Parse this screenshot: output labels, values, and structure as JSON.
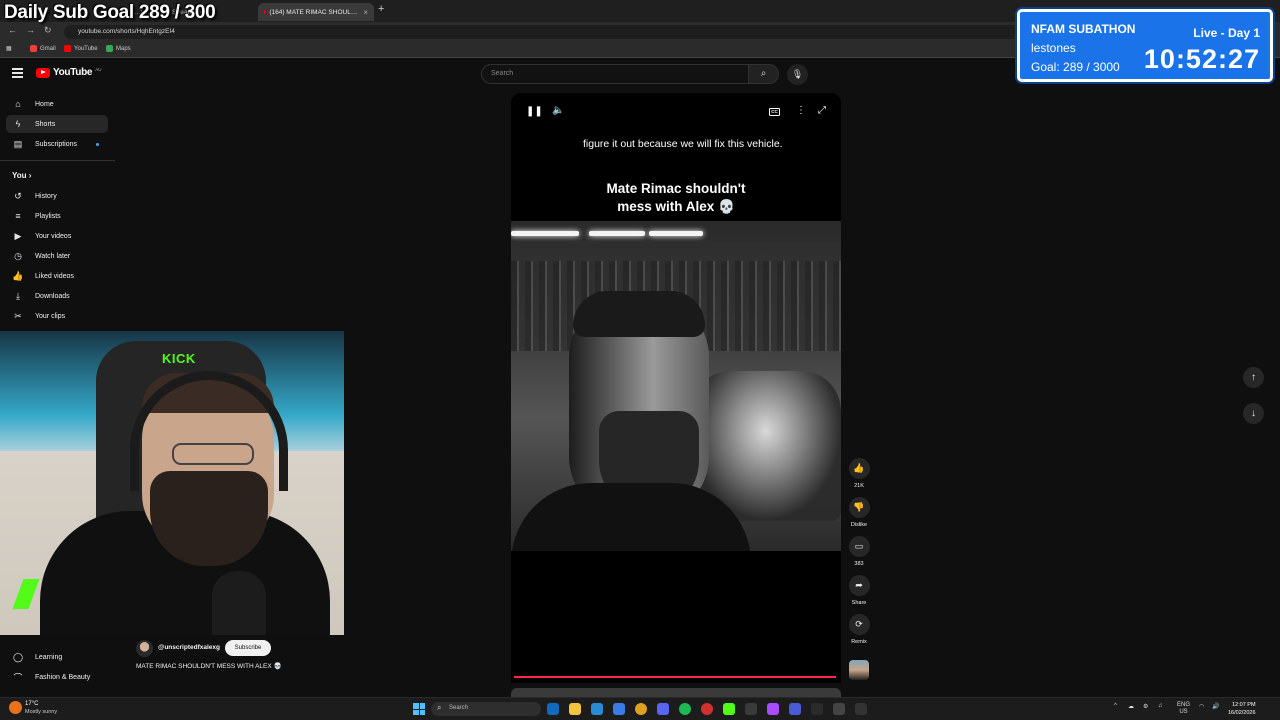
{
  "browser": {
    "tabs": [
      {
        "label": "…ts…S…nd Stream",
        "active": false
      },
      {
        "label": "(164) MATE RIMAC SHOUL…",
        "active": true
      }
    ],
    "url": "youtube.com/shorts/HqhEntgzEI4",
    "bookmarks": [
      "Gmail",
      "YouTube",
      "Maps"
    ]
  },
  "overlay": {
    "sub_goal": "Daily Sub Goal  289 / 300",
    "subathon_title": "NFAM SUBATHON",
    "live_day": "Live - Day 1",
    "username": "lestones",
    "goal": "Goal: 289 / 3000",
    "timer": "10:52:27"
  },
  "youtube": {
    "logo_text": "YouTube",
    "region": "AU",
    "search_placeholder": "Search"
  },
  "sidebar": {
    "main": [
      {
        "label": "Home",
        "icon": "home-icon"
      },
      {
        "label": "Shorts",
        "icon": "shorts-icon",
        "active": true
      },
      {
        "label": "Subscriptions",
        "icon": "subscriptions-icon"
      }
    ],
    "you_heading": "You",
    "you_items": [
      {
        "label": "History",
        "icon": "history-icon"
      },
      {
        "label": "Playlists",
        "icon": "playlists-icon"
      },
      {
        "label": "Your videos",
        "icon": "your-videos-icon"
      },
      {
        "label": "Watch later",
        "icon": "watch-later-icon"
      },
      {
        "label": "Liked videos",
        "icon": "like-icon"
      },
      {
        "label": "Downloads",
        "icon": "download-icon"
      },
      {
        "label": "Your clips",
        "icon": "scissors-icon"
      }
    ],
    "lower_items": [
      {
        "label": "Learning",
        "icon": "learning-icon"
      },
      {
        "label": "Fashion & Beauty",
        "icon": "hanger-icon"
      }
    ]
  },
  "webcam": {
    "chair_brand": "KICK"
  },
  "short": {
    "caption_line": "figure it out because we will fix this vehicle.",
    "title_caption": "Mate Rimac shouldn't mess with Alex 💀",
    "cc_label": "CC",
    "channel": "@unscriptedfxalexg",
    "subscribe_label": "Subscribe",
    "video_title": "MATE RIMAC SHOULDN'T MESS WITH ALEX 💀",
    "actions": [
      {
        "label": "21K",
        "icon": "like-icon"
      },
      {
        "label": "Dislike",
        "icon": "dislike-icon"
      },
      {
        "label": "383",
        "icon": "comment-icon"
      },
      {
        "label": "Share",
        "icon": "share-icon"
      },
      {
        "label": "Remix",
        "icon": "remix-icon"
      }
    ]
  },
  "taskbar": {
    "temperature": "17°C",
    "condition": "Mostly sunny",
    "search_label": "Search",
    "language": "ENG",
    "language_region": "US",
    "time": "12:07 PM",
    "date": "16/02/2026"
  }
}
